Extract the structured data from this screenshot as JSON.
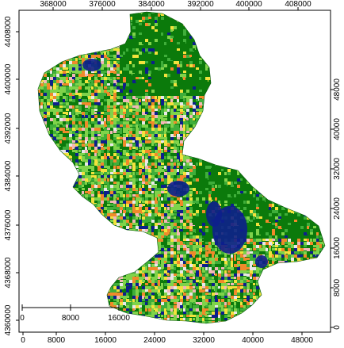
{
  "axes": {
    "top_ticks": [
      "368000",
      "376000",
      "384000",
      "392000",
      "400000",
      "408000"
    ],
    "bottom_ticks": [
      "0",
      "8000",
      "16000",
      "24000",
      "32000",
      "40000",
      "48000"
    ],
    "left_ticks": [
      "4408000",
      "4400000",
      "4392000",
      "4384000",
      "4376000",
      "4368000",
      "4360000"
    ],
    "right_ticks": [
      "0",
      "8000",
      "16000",
      "24000",
      "32000",
      "40000",
      "48000"
    ]
  },
  "scalebar": {
    "labels": [
      "0",
      "8000",
      "16000"
    ]
  },
  "colors": {
    "dark_green": "#0b7a0b",
    "light_green": "#7fd34a",
    "medium_green": "#3fae3a",
    "blue": "#0d1f8c",
    "orange": "#f08a2a",
    "yellow": "#f2e23c",
    "pink": "#f2b7b7",
    "white_patch": "#e8e8e8"
  },
  "map_palette": [
    "dark_green",
    "light_green",
    "medium_green",
    "blue",
    "orange",
    "yellow",
    "pink",
    "white_patch"
  ]
}
